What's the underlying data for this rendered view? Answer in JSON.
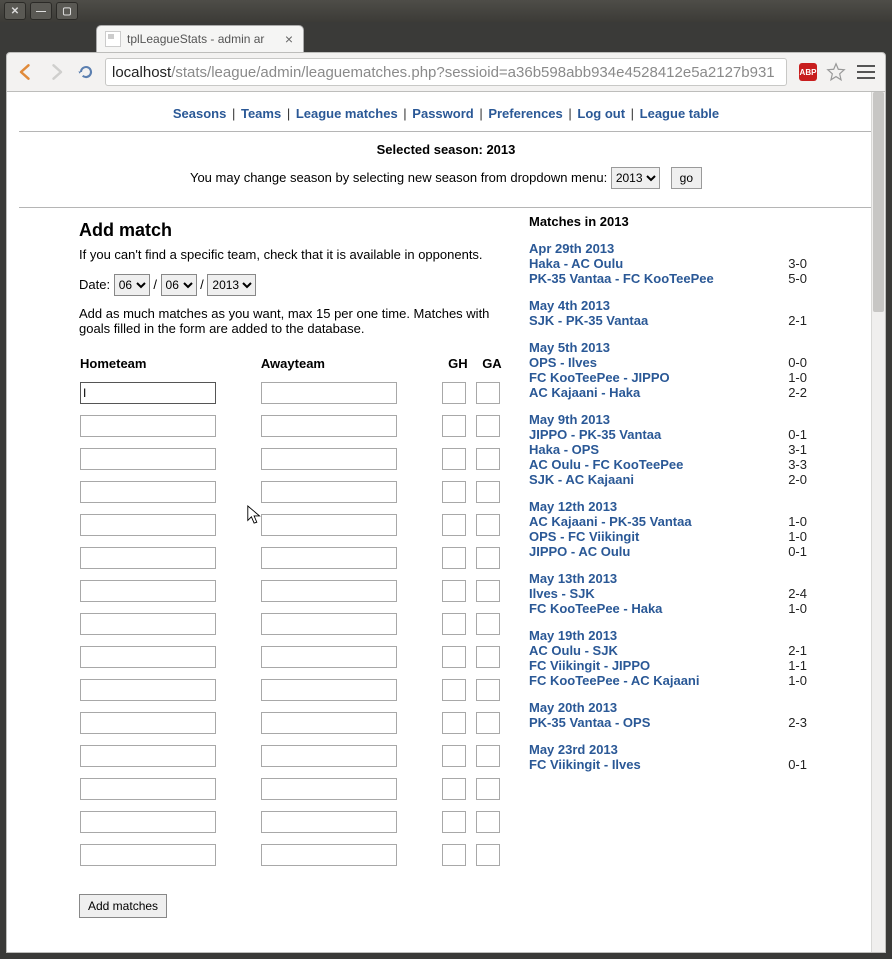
{
  "window": {
    "tab_title": "tplLeagueStats - admin ar",
    "url_host": "localhost",
    "url_path": "/stats/league/admin/leaguematches.php?sessioid=a36b598abb934e4528412e5a2127b931",
    "abp_label": "ABP"
  },
  "nav": {
    "items": [
      "Seasons",
      "Teams",
      "League matches",
      "Password",
      "Preferences",
      "Log out",
      "League table"
    ]
  },
  "season": {
    "selected_label": "Selected season: 2013",
    "change_text": "You may change season by selecting new season from dropdown menu:",
    "dropdown_value": "2013",
    "go_label": "go"
  },
  "form": {
    "heading": "Add match",
    "hint": "If you can't find a specific team, check that it is available in opponents.",
    "date_label": "Date:",
    "date_day": "06",
    "date_month": "06",
    "date_year": "2013",
    "note": "Add as much matches as you want, max 15 per one time. Matches with goals filled in the form are added to the database.",
    "col_home": "Hometeam",
    "col_away": "Awayteam",
    "col_gh": "GH",
    "col_ga": "GA",
    "first_value": "I",
    "row_count": 15,
    "submit_label": "Add matches"
  },
  "matches": {
    "heading": "Matches in 2013",
    "groups": [
      {
        "date": "Apr 29th 2013",
        "rows": [
          {
            "t": "Haka - AC Oulu",
            "s": "3-0"
          },
          {
            "t": "PK-35 Vantaa - FC KooTeePee",
            "s": "5-0"
          }
        ]
      },
      {
        "date": "May 4th 2013",
        "rows": [
          {
            "t": "SJK - PK-35 Vantaa",
            "s": "2-1"
          }
        ]
      },
      {
        "date": "May 5th 2013",
        "rows": [
          {
            "t": "OPS - Ilves",
            "s": "0-0"
          },
          {
            "t": "FC KooTeePee - JIPPO",
            "s": "1-0"
          },
          {
            "t": "AC Kajaani - Haka",
            "s": "2-2"
          }
        ]
      },
      {
        "date": "May 9th 2013",
        "rows": [
          {
            "t": "JIPPO - PK-35 Vantaa",
            "s": "0-1"
          },
          {
            "t": "Haka - OPS",
            "s": "3-1"
          },
          {
            "t": "AC Oulu - FC KooTeePee",
            "s": "3-3"
          },
          {
            "t": "SJK - AC Kajaani",
            "s": "2-0"
          }
        ]
      },
      {
        "date": "May 12th 2013",
        "rows": [
          {
            "t": "AC Kajaani - PK-35 Vantaa",
            "s": "1-0"
          },
          {
            "t": "OPS - FC Viikingit",
            "s": "1-0"
          },
          {
            "t": "JIPPO - AC Oulu",
            "s": "0-1"
          }
        ]
      },
      {
        "date": "May 13th 2013",
        "rows": [
          {
            "t": "Ilves - SJK",
            "s": "2-4"
          },
          {
            "t": "FC KooTeePee - Haka",
            "s": "1-0"
          }
        ]
      },
      {
        "date": "May 19th 2013",
        "rows": [
          {
            "t": "AC Oulu - SJK",
            "s": "2-1"
          },
          {
            "t": "FC Viikingit - JIPPO",
            "s": "1-1"
          },
          {
            "t": "FC KooTeePee - AC Kajaani",
            "s": "1-0"
          }
        ]
      },
      {
        "date": "May 20th 2013",
        "rows": [
          {
            "t": "PK-35 Vantaa - OPS",
            "s": "2-3"
          }
        ]
      },
      {
        "date": "May 23rd 2013",
        "rows": [
          {
            "t": "FC Viikingit - Ilves",
            "s": "0-1"
          }
        ]
      }
    ]
  }
}
